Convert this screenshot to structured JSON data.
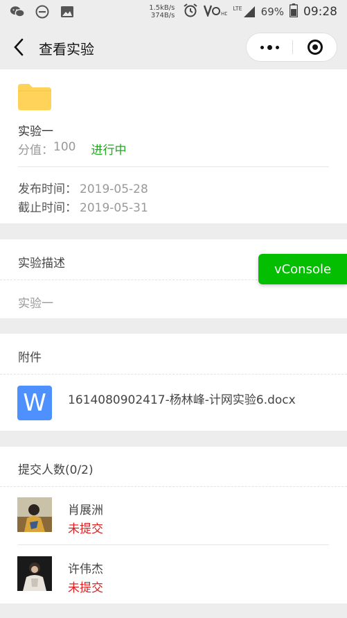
{
  "statusbar": {
    "net_up": "1.5kB/s",
    "net_down": "374B/s",
    "network": "LTE",
    "battery": "69%",
    "time": "09:28",
    "icons": [
      "wechat-icon",
      "dnd-icon",
      "image-icon",
      "alarm-icon",
      "volte-icon",
      "signal-icon",
      "battery-icon"
    ]
  },
  "navbar": {
    "title": "查看实验"
  },
  "experiment": {
    "name": "实验一",
    "score_label": "分值：",
    "score": "100",
    "status": "进行中",
    "publish_label": "发布时间：",
    "publish_date": "2019-05-28",
    "deadline_label": "截止时间：",
    "deadline_date": "2019-05-31"
  },
  "description": {
    "title": "实验描述",
    "text": "实验一"
  },
  "vconsole": {
    "label": "vConsole"
  },
  "attachments": {
    "title": "附件",
    "icon_letter": "W",
    "file_name": "1614080902417-杨林峰-计网实验6.docx"
  },
  "submissions": {
    "title": "提交人数(0/2)",
    "members": [
      {
        "name": "肖展洲",
        "status": "未提交"
      },
      {
        "name": "许伟杰",
        "status": "未提交"
      }
    ]
  },
  "colors": {
    "status_green": "#1aad19",
    "not_submitted_red": "#e02020",
    "word_blue": "#4d90fe",
    "folder_yellow": "#ffd35a",
    "vconsole_green": "#04be02"
  }
}
